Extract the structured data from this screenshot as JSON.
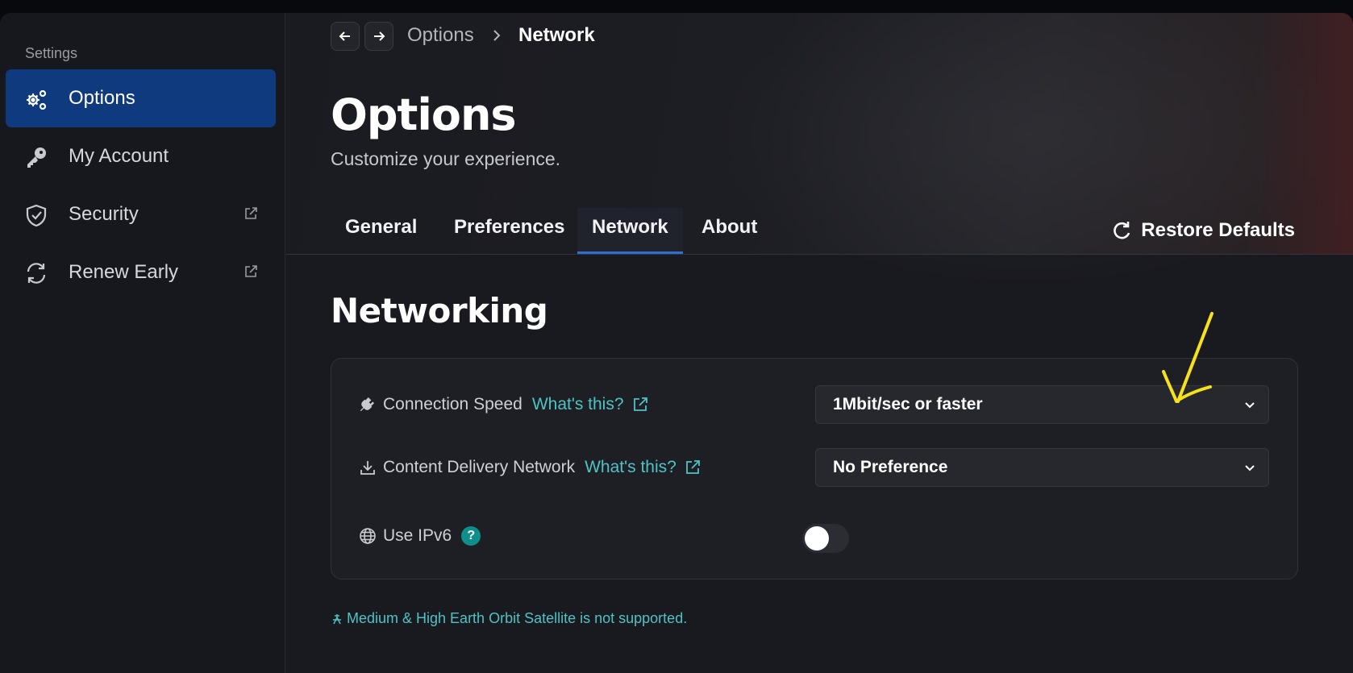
{
  "sidebar": {
    "heading": "Settings",
    "items": [
      {
        "label": "Options",
        "icon": "gears-icon",
        "active": true
      },
      {
        "label": "My Account",
        "icon": "key-icon"
      },
      {
        "label": "Security",
        "icon": "shield-icon",
        "external": true
      },
      {
        "label": "Renew Early",
        "icon": "refresh-icon",
        "external": true
      }
    ]
  },
  "breadcrumb": {
    "items": [
      "Options",
      "Network"
    ]
  },
  "header": {
    "title": "Options",
    "subtitle": "Customize your experience."
  },
  "tabs": [
    {
      "label": "General"
    },
    {
      "label": "Preferences"
    },
    {
      "label": "Network",
      "active": true
    },
    {
      "label": "About"
    }
  ],
  "restore_label": "Restore Defaults",
  "section_title": "Networking",
  "settings": {
    "connection_speed": {
      "label": "Connection Speed",
      "link": "What's this?",
      "value": "1Mbit/sec or faster"
    },
    "cdn": {
      "label": "Content Delivery Network",
      "link": "What's this?",
      "value": "No Preference"
    },
    "ipv6": {
      "label": "Use IPv6",
      "help": "?",
      "enabled": false
    }
  },
  "footnote": "Medium & High Earth Orbit Satellite is not supported.",
  "colors": {
    "accent": "#0f3a7e",
    "link": "#4fc3c4",
    "tab_underline": "#2e6fcf",
    "annotation": "#f5e21b"
  }
}
